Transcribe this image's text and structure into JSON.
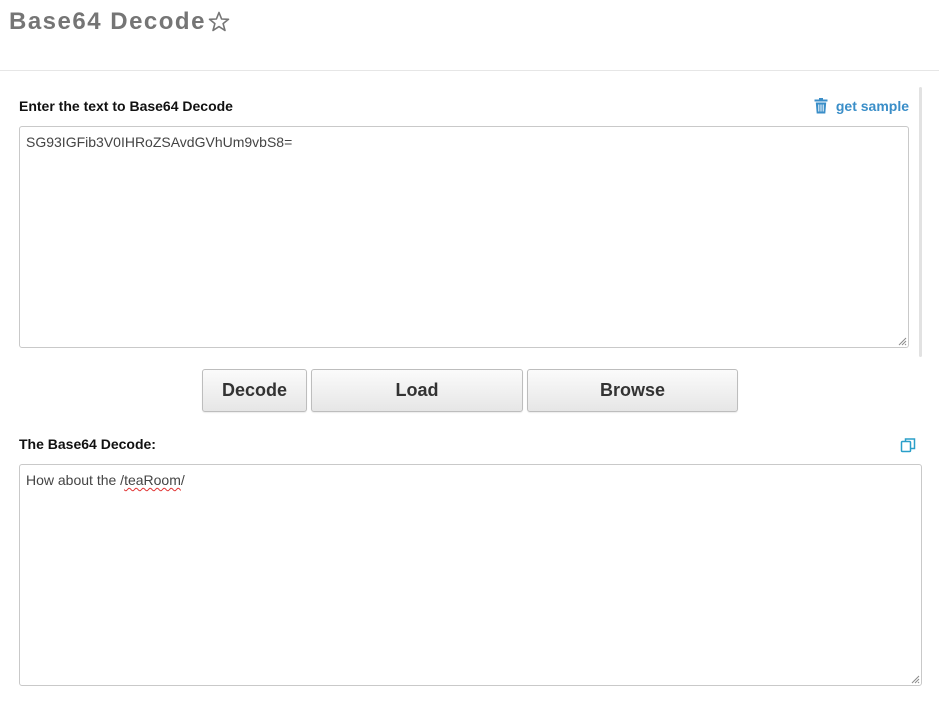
{
  "header": {
    "title": "Base64 Decode",
    "favorite_icon": "star-outline-icon"
  },
  "input_section": {
    "label": "Enter the text to Base64 Decode",
    "sample_link": {
      "label": "get sample",
      "icon": "trash-icon",
      "color": "#3a8ec8"
    },
    "value": "SG93IGFib3V0IHRoZSAvdGVhUm9vbS8="
  },
  "actions": {
    "decode_label": "Decode",
    "load_label": "Load",
    "browse_label": "Browse"
  },
  "output_section": {
    "label": "The Base64 Decode:",
    "copy_icon": "copy-icon",
    "value_prefix": "How about the /",
    "value_misspelled": "teaRoom",
    "value_suffix": "/"
  }
}
